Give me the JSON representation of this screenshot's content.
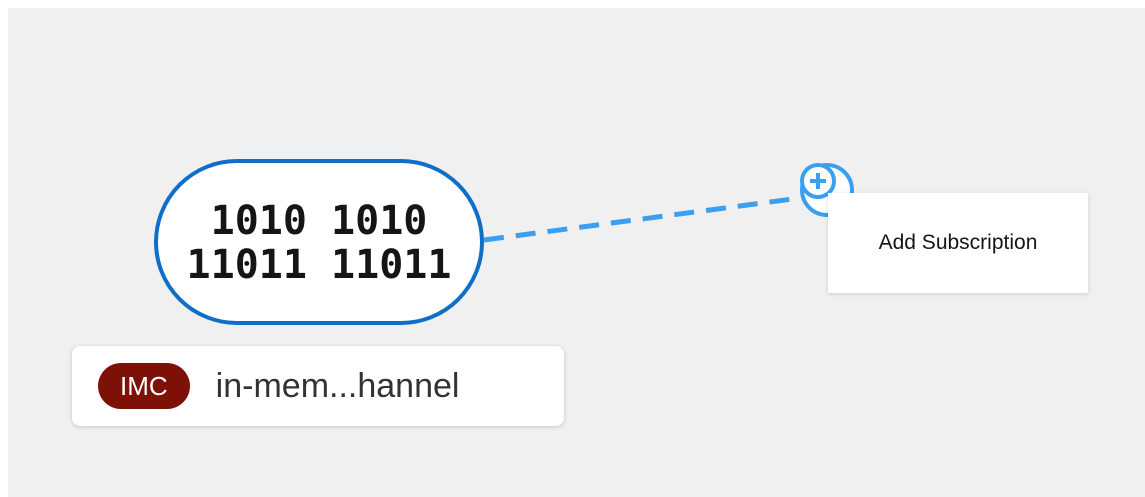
{
  "channel_node": {
    "glyph_lines": [
      "1010 1010",
      "11011 11011"
    ],
    "badge": "IMC",
    "name": "in-mem...hannel",
    "badge_color": "#7d1007"
  },
  "connector": {
    "icon": "plus-circle-icon",
    "color": "#3a9ff0"
  },
  "tooltip": {
    "text": "Add Subscription"
  }
}
